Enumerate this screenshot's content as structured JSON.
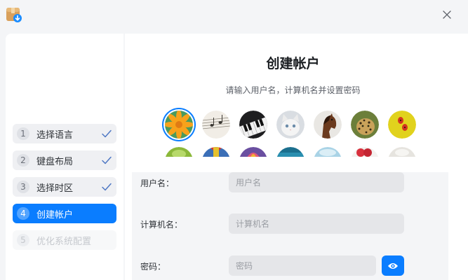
{
  "window": {
    "app_icon": "installer-package-icon",
    "close_icon": "close-icon"
  },
  "sidebar": {
    "steps": [
      {
        "number": "1",
        "label": "选择语言",
        "state": "done"
      },
      {
        "number": "2",
        "label": "键盘布局",
        "state": "done"
      },
      {
        "number": "3",
        "label": "选择时区",
        "state": "done"
      },
      {
        "number": "4",
        "label": "创建帐户",
        "state": "active"
      },
      {
        "number": "5",
        "label": "优化系统配置",
        "state": "disabled"
      }
    ],
    "check_icon": "checkmark-icon",
    "accent_color": "#0a7dff"
  },
  "main": {
    "title": "创建帐户",
    "subtitle": "请输入用户名，计算机名并设置密码",
    "avatars": [
      {
        "name": "avatar-flower",
        "selected": true
      },
      {
        "name": "avatar-sheet-music",
        "selected": false
      },
      {
        "name": "avatar-piano",
        "selected": false
      },
      {
        "name": "avatar-kitten",
        "selected": false
      },
      {
        "name": "avatar-horse",
        "selected": false
      },
      {
        "name": "avatar-leopard",
        "selected": false
      },
      {
        "name": "avatar-ladybug",
        "selected": false
      },
      {
        "name": "avatar-leaf",
        "selected": false
      },
      {
        "name": "avatar-parrot",
        "selected": false
      },
      {
        "name": "avatar-balloon",
        "selected": false
      },
      {
        "name": "avatar-ocean",
        "selected": false
      },
      {
        "name": "avatar-sky",
        "selected": false
      },
      {
        "name": "avatar-rose",
        "selected": false
      },
      {
        "name": "avatar-cloud",
        "selected": false
      }
    ],
    "form": {
      "username": {
        "label": "用户名：",
        "placeholder": "用户名",
        "value": ""
      },
      "computer_name": {
        "label": "计算机名：",
        "placeholder": "计算机名",
        "value": ""
      },
      "password": {
        "label": "密码：",
        "placeholder": "密码",
        "value": "",
        "toggle_icon": "eye-icon"
      }
    }
  }
}
